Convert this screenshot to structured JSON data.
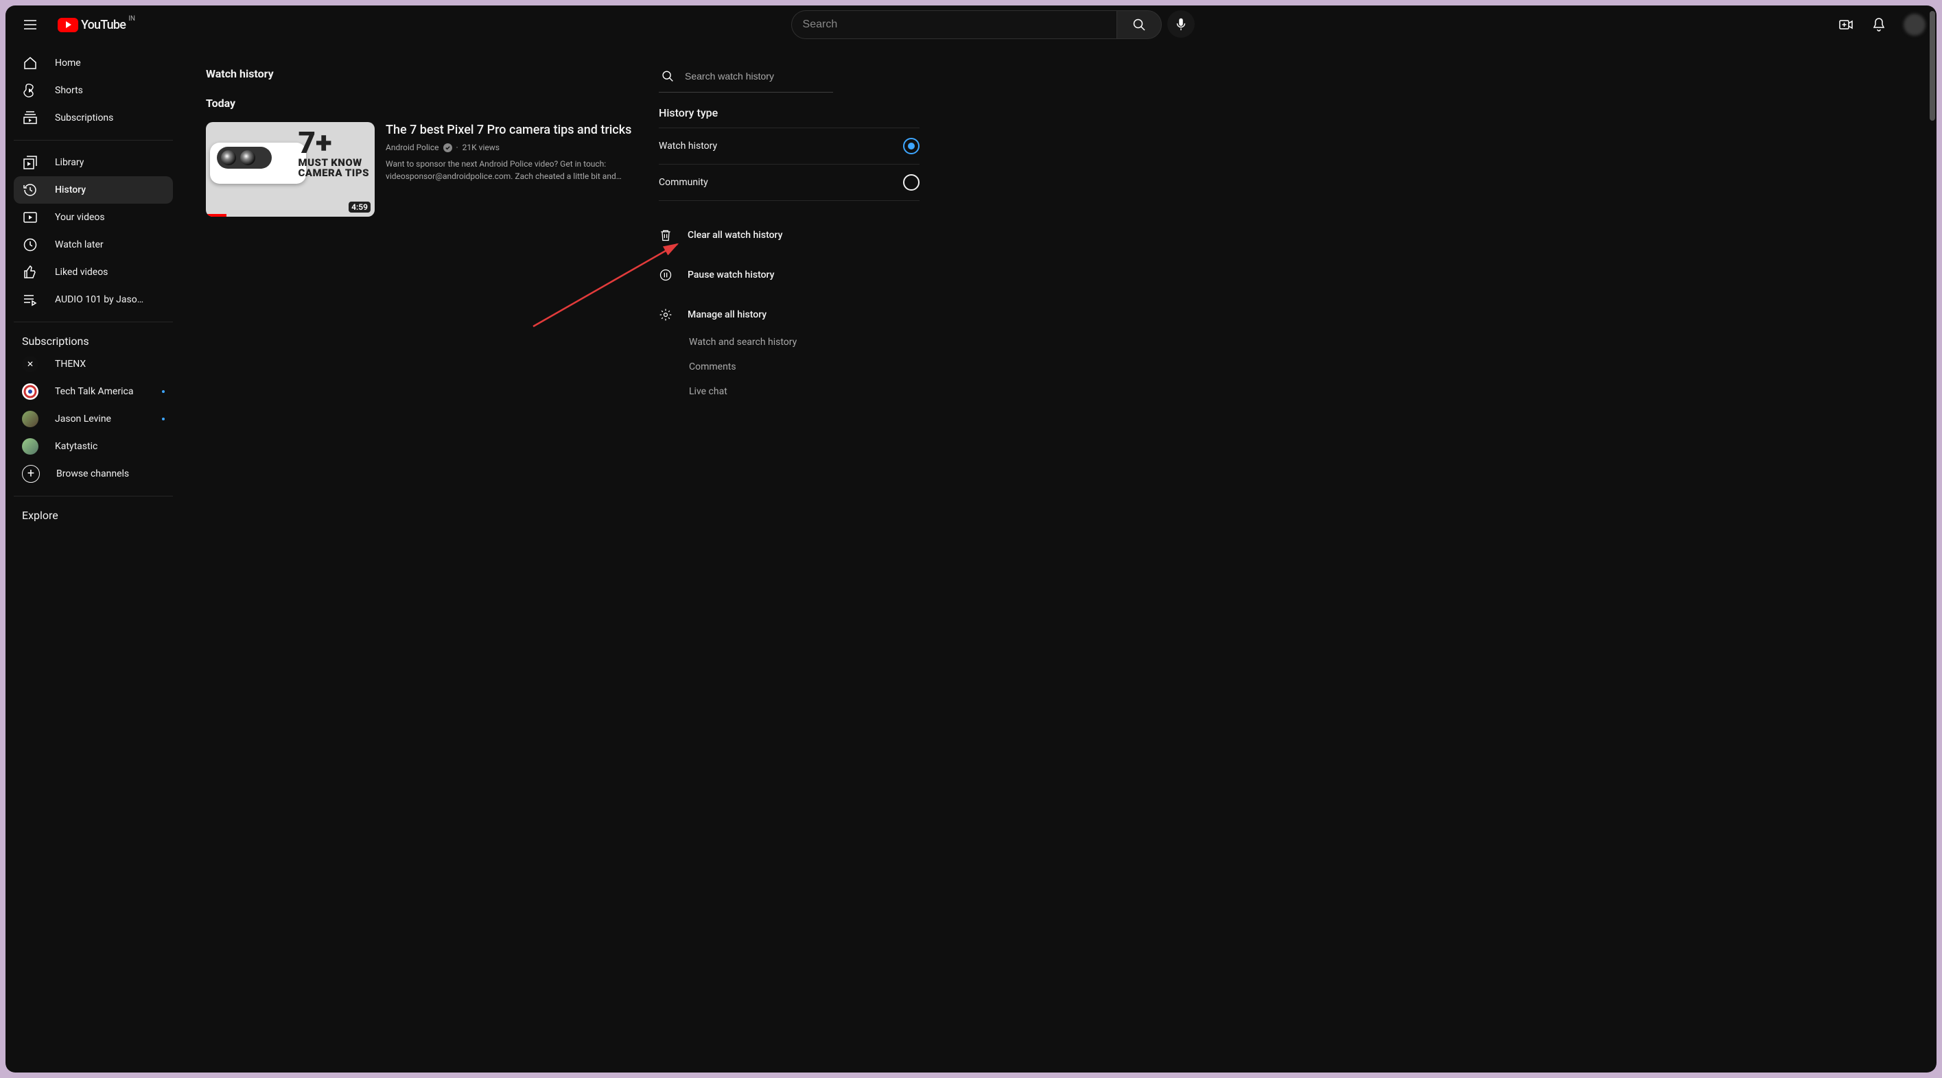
{
  "header": {
    "logo_text": "YouTube",
    "country_code": "IN",
    "search_placeholder": "Search"
  },
  "sidebar": {
    "primary": [
      {
        "label": "Home"
      },
      {
        "label": "Shorts"
      },
      {
        "label": "Subscriptions"
      }
    ],
    "secondary": [
      {
        "label": "Library"
      },
      {
        "label": "History"
      },
      {
        "label": "Your videos"
      },
      {
        "label": "Watch later"
      },
      {
        "label": "Liked videos"
      },
      {
        "label": "AUDIO 101 by Jaso…"
      }
    ],
    "subs_header": "Subscriptions",
    "subscriptions": [
      {
        "label": "THENX",
        "new": false,
        "avatar_bg": "#111"
      },
      {
        "label": "Tech Talk America",
        "new": true,
        "avatar_bg": "#fff"
      },
      {
        "label": "Jason Levine",
        "new": true,
        "avatar_bg": "#5a4a3a"
      },
      {
        "label": "Katytastic",
        "new": false,
        "avatar_bg": "#7aa96b"
      }
    ],
    "browse_label": "Browse channels",
    "explore_header": "Explore"
  },
  "main": {
    "page_title": "Watch history",
    "section_title": "Today",
    "video": {
      "title": "The 7 best Pixel 7 Pro camera tips and tricks",
      "channel": "Android Police",
      "views": "21K views",
      "desc": "Want to sponsor the next Android Police video? Get in touch: videosponsor@androidpolice.com. Zach cheated a little bit and…",
      "duration": "4:59",
      "thumb_big": "7+",
      "thumb_line1": "MUST KNOW",
      "thumb_line2": "CAMERA TIPS"
    }
  },
  "rail": {
    "search_placeholder": "Search watch history",
    "type_header": "History type",
    "types": [
      {
        "label": "Watch history",
        "selected": true
      },
      {
        "label": "Community",
        "selected": false
      }
    ],
    "clear_label": "Clear all watch history",
    "pause_label": "Pause watch history",
    "manage_label": "Manage all history",
    "sublinks": [
      "Watch and search history",
      "Comments",
      "Live chat"
    ]
  }
}
